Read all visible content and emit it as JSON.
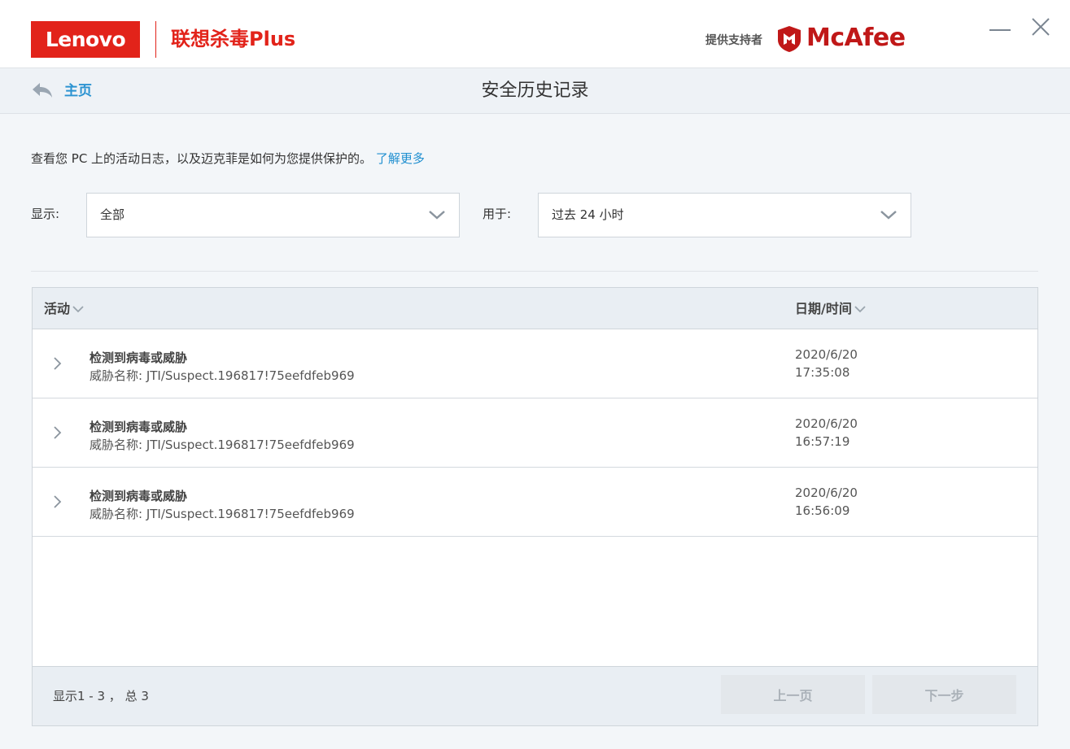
{
  "header": {
    "lenovo_logo": "Lenovo",
    "product_name": "联想杀毒Plus",
    "powered_by": "提供支持者",
    "mcafee_logo": "McAfee",
    "minimize_icon": "minimize-icon",
    "close_icon": "close-icon"
  },
  "nav": {
    "back_icon": "back-arrow-icon",
    "home_label": "主页",
    "page_title": "安全历史记录"
  },
  "intro": {
    "text": "查看您 PC 上的活动日志，以及迈克菲是如何为您提供保护的。",
    "learn_more": "了解更多"
  },
  "filters": {
    "show_label": "显示:",
    "show_value": "全部",
    "for_label": "用于:",
    "for_value": "过去 24 小时"
  },
  "table": {
    "columns": [
      "活动",
      "日期/时间"
    ],
    "rows": [
      {
        "title": "检测到病毒或威胁",
        "subtitle": "威胁名称: JTI/Suspect.196817!75eefdfeb969",
        "date": "2020/6/20",
        "time": "17:35:08"
      },
      {
        "title": "检测到病毒或威胁",
        "subtitle": "威胁名称: JTI/Suspect.196817!75eefdfeb969",
        "date": "2020/6/20",
        "time": "16:57:19"
      },
      {
        "title": "检测到病毒或威胁",
        "subtitle": "威胁名称: JTI/Suspect.196817!75eefdfeb969",
        "date": "2020/6/20",
        "time": "16:56:09"
      }
    ],
    "footer": {
      "count_text": "显示1 - 3 ， 总 3",
      "prev_label": "上一页",
      "next_label": "下一步"
    }
  },
  "colors": {
    "lenovo_red": "#e2231a",
    "mcafee_red": "#c01818",
    "link_blue": "#1f8fd0"
  }
}
